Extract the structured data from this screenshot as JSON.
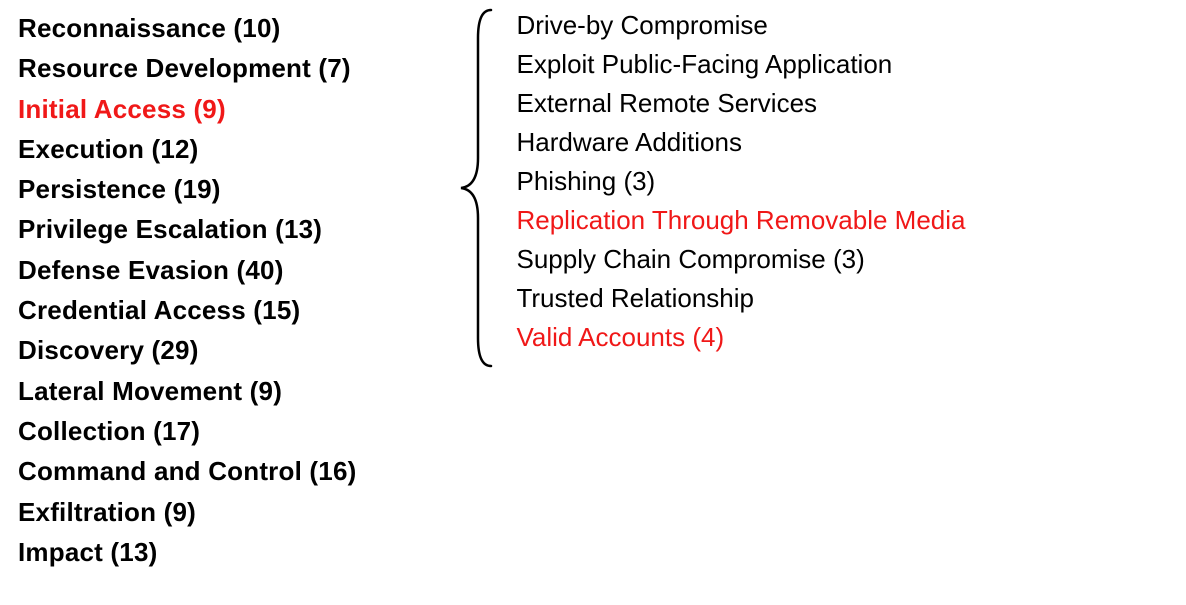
{
  "colors": {
    "highlight": "#f01818",
    "text": "#000000"
  },
  "tactics": [
    {
      "label": "Reconnaissance (10)",
      "selected": false
    },
    {
      "label": "Resource Development (7)",
      "selected": false
    },
    {
      "label": "Initial Access (9)",
      "selected": true
    },
    {
      "label": "Execution (12)",
      "selected": false
    },
    {
      "label": "Persistence (19)",
      "selected": false
    },
    {
      "label": "Privilege Escalation (13)",
      "selected": false
    },
    {
      "label": "Defense Evasion (40)",
      "selected": false
    },
    {
      "label": "Credential Access (15)",
      "selected": false
    },
    {
      "label": "Discovery (29)",
      "selected": false
    },
    {
      "label": "Lateral Movement (9)",
      "selected": false
    },
    {
      "label": "Collection (17)",
      "selected": false
    },
    {
      "label": "Command and Control (16)",
      "selected": false
    },
    {
      "label": "Exfiltration (9)",
      "selected": false
    },
    {
      "label": "Impact (13)",
      "selected": false
    }
  ],
  "techniques": [
    {
      "label": "Drive-by Compromise",
      "selected": false
    },
    {
      "label": "Exploit Public-Facing Application",
      "selected": false
    },
    {
      "label": "External Remote Services",
      "selected": false
    },
    {
      "label": "Hardware Additions",
      "selected": false
    },
    {
      "label": "Phishing (3)",
      "selected": false
    },
    {
      "label": "Replication Through Removable Media",
      "selected": true
    },
    {
      "label": "Supply Chain Compromise (3)",
      "selected": false
    },
    {
      "label": "Trusted Relationship",
      "selected": false
    },
    {
      "label": "Valid Accounts (4)",
      "selected": true
    }
  ]
}
